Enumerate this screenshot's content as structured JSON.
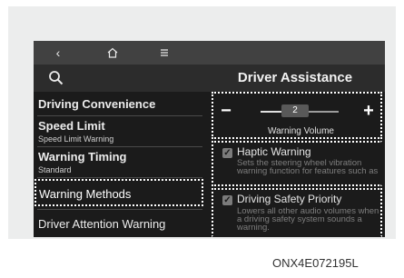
{
  "topbar": {
    "back_icon": "chevron-left-icon",
    "home_icon": "home-icon",
    "menu_icon": "menu-icon"
  },
  "header": {
    "title": "Driver Assistance",
    "search_icon": "search-icon"
  },
  "sidebar": {
    "items": [
      {
        "label": "Driving Convenience",
        "sublabel": ""
      },
      {
        "label": "Speed Limit",
        "sublabel": "Speed Limit Warning"
      },
      {
        "label": "Warning Timing",
        "sublabel": "Standard"
      },
      {
        "label": "Warning Methods",
        "sublabel": ""
      },
      {
        "label": "Driver Attention Warning",
        "sublabel": ""
      }
    ]
  },
  "volume": {
    "minus_label": "−",
    "plus_label": "+",
    "value": "2",
    "level_fraction": 0.55,
    "label": "Warning Volume"
  },
  "options": [
    {
      "label": "Haptic Warning",
      "checked": true,
      "description": "Sets the steering wheel vibration warning function for features such as"
    },
    {
      "label": "Driving Safety Priority",
      "checked": true,
      "description": "Lowers all other audio volumes when a driving safety system sounds a warning."
    }
  ],
  "caption": "ONX4E072195L",
  "colors": {
    "screen_bg": "#1b1b1b",
    "topbar_bg": "#414141",
    "highlight_dots": "#ffffff"
  }
}
